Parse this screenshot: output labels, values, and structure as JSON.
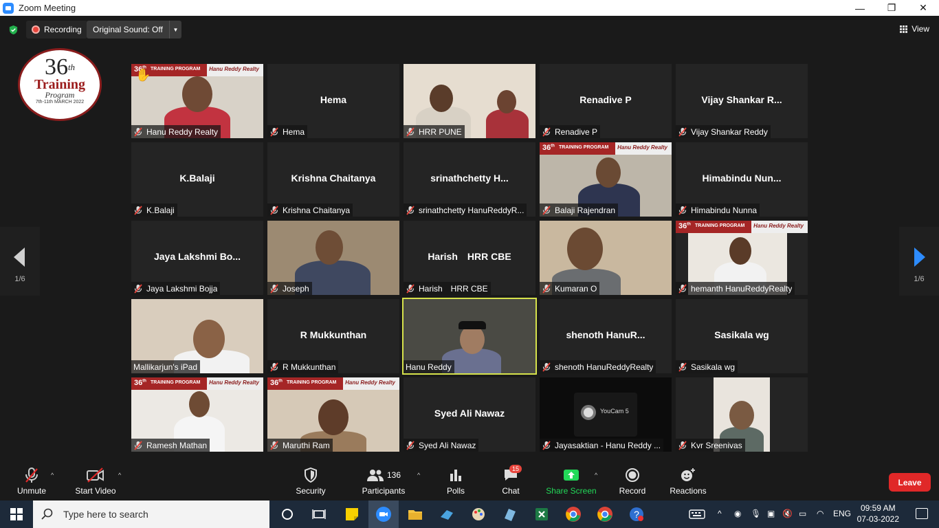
{
  "window": {
    "title": "Zoom Meeting",
    "controls": [
      "—",
      "❐",
      "✕"
    ]
  },
  "topbar": {
    "recording_label": "Recording",
    "sound_label": "Original Sound: Off",
    "view_label": "View"
  },
  "logo": {
    "number": "36",
    "suffix": "th",
    "line1": "Training",
    "line2": "Program",
    "dates": "7th-11th MARCH 2022"
  },
  "nav": {
    "left_count": "1/6",
    "right_count": "1/6"
  },
  "tiles": [
    {
      "big": "",
      "label": "Hanu Reddy Realty",
      "muted": true,
      "video": true
    },
    {
      "big": "Hema",
      "label": "Hema",
      "muted": true,
      "video": false
    },
    {
      "big": "",
      "label": "HRR PUNE",
      "muted": true,
      "video": true
    },
    {
      "big": "Renadive P",
      "label": "Renadive P",
      "muted": true,
      "video": false
    },
    {
      "big": "Vijay  Shankar  R...",
      "label": "Vijay Shankar Reddy",
      "muted": true,
      "video": false
    },
    {
      "big": "K.Balaji",
      "label": "K.Balaji",
      "muted": true,
      "video": false
    },
    {
      "big": "Krishna Chaitanya",
      "label": "Krishna Chaitanya",
      "muted": true,
      "video": false
    },
    {
      "big": "srinathchetty  H...",
      "label": "srinathchetty HanuReddyR...",
      "muted": true,
      "video": false
    },
    {
      "big": "",
      "label": "Balaji Rajendran",
      "muted": true,
      "video": true
    },
    {
      "big": "Himabindu  Nun...",
      "label": "Himabindu Nunna",
      "muted": true,
      "video": false
    },
    {
      "big": "Jaya Lakshmi  Bo...",
      "label": "Jaya Lakshmi Bojja",
      "muted": true,
      "video": false
    },
    {
      "big": "",
      "label": "Joseph",
      "muted": true,
      "video": true
    },
    {
      "big": "Harish HRR  CBE",
      "label": "Harish HRR CBE",
      "muted": true,
      "video": false
    },
    {
      "big": "",
      "label": "Kumaran O",
      "muted": true,
      "video": true
    },
    {
      "big": "",
      "label": "hemanth HanuReddyRealty",
      "muted": true,
      "video": true
    },
    {
      "big": "",
      "label": "Mallikarjun's iPad",
      "muted": false,
      "video": true
    },
    {
      "big": "R Mukkunthan",
      "label": "R Mukkunthan",
      "muted": true,
      "video": false
    },
    {
      "big": "",
      "label": "Hanu Reddy",
      "muted": false,
      "video": true,
      "active": true
    },
    {
      "big": "shenoth  HanuR...",
      "label": "shenoth HanuReddyRealty",
      "muted": true,
      "video": false
    },
    {
      "big": "Sasikala wg",
      "label": "Sasikala wg",
      "muted": true,
      "video": false
    },
    {
      "big": "",
      "label": "Ramesh Mathan",
      "muted": true,
      "video": true
    },
    {
      "big": "",
      "label": "Maruthi Ram",
      "muted": true,
      "video": true
    },
    {
      "big": "Syed Ali Nawaz",
      "label": "Syed Ali Nawaz",
      "muted": true,
      "video": false
    },
    {
      "big": "",
      "label": "Jayasaktian - Hanu Reddy ...",
      "muted": true,
      "video": true
    },
    {
      "big": "",
      "label": "Kvr Sreenivas",
      "muted": true,
      "video": true
    }
  ],
  "banner": {
    "num": "36",
    "num_sup": "th",
    "program": "TRAINING PROGRAM",
    "brand": "Hanu Reddy Realty"
  },
  "youcam": {
    "title": "YouCam 5"
  },
  "toolbar": {
    "unmute": "Unmute",
    "start_video": "Start Video",
    "security": "Security",
    "participants": "Participants",
    "participants_count": "136",
    "polls": "Polls",
    "chat": "Chat",
    "chat_badge": "15",
    "share": "Share Screen",
    "record": "Record",
    "reactions": "Reactions",
    "leave": "Leave"
  },
  "taskbar": {
    "search_placeholder": "Type here to search",
    "lang": "ENG",
    "time": "09:59 AM",
    "date": "07-03-2022"
  },
  "colors": {
    "accent": "#2d8cff",
    "share_green": "#23d959",
    "leave_red": "#e02828",
    "active_outline": "#d7e34b"
  }
}
